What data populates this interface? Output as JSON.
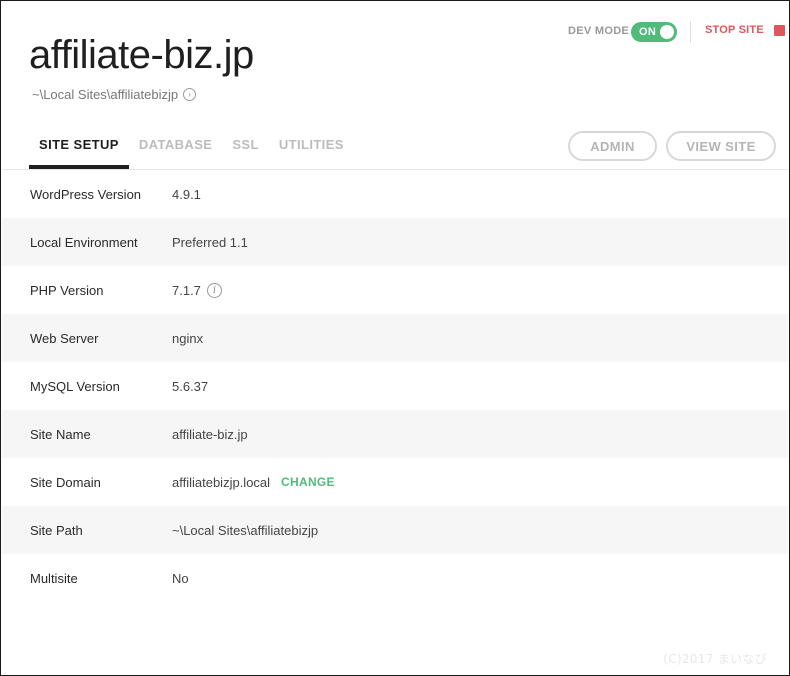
{
  "site": {
    "title": "affiliate-biz.jp",
    "path": "~\\Local Sites\\affiliatebizjp"
  },
  "header": {
    "dev_mode_label": "DEV MODE",
    "dev_mode_toggle": "ON",
    "dev_mode_on": true,
    "stop_site_label": "STOP SITE"
  },
  "tabs": [
    {
      "label": "SITE SETUP",
      "active": true
    },
    {
      "label": "DATABASE",
      "active": false
    },
    {
      "label": "SSL",
      "active": false
    },
    {
      "label": "UTILITIES",
      "active": false
    }
  ],
  "buttons": {
    "admin": "ADMIN",
    "view_site": "VIEW SITE"
  },
  "setup_rows": [
    {
      "label": "WordPress Version",
      "value": "4.9.1"
    },
    {
      "label": "Local Environment",
      "value": "Preferred 1.1"
    },
    {
      "label": "PHP Version",
      "value": "7.1.7"
    },
    {
      "label": "Web Server",
      "value": "nginx"
    },
    {
      "label": "MySQL Version",
      "value": "5.6.37"
    },
    {
      "label": "Site Name",
      "value": "affiliate-biz.jp"
    },
    {
      "label": "Site Domain",
      "value": "affiliatebizjp.local",
      "action": "CHANGE"
    },
    {
      "label": "Site Path",
      "value": "~\\Local Sites\\affiliatebizjp"
    },
    {
      "label": "Multisite",
      "value": "No"
    }
  ],
  "watermark": "(C)2017 まいなび",
  "colors": {
    "accent_green": "#51bb7b",
    "stop_red": "#e0565b",
    "row_stripe": "#f6f6f6"
  },
  "icons": {
    "path_go": "circle-chevron-right-icon",
    "php_info": "info-circle-icon",
    "stop": "square-stop-icon"
  }
}
